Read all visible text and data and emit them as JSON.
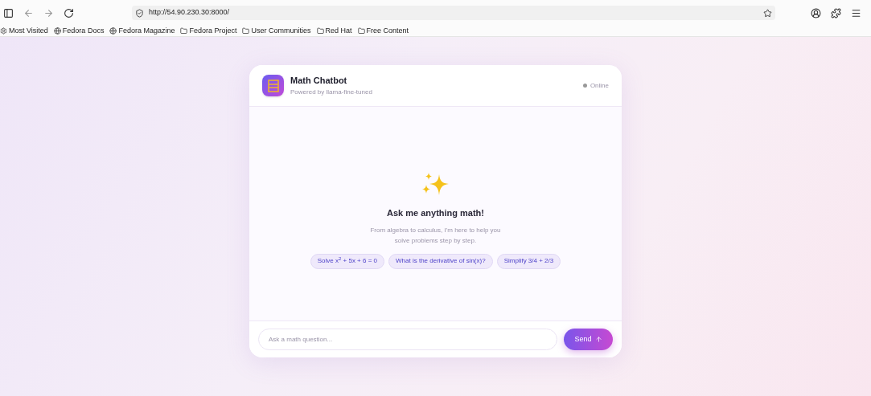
{
  "browser": {
    "url": "http://54.90.230.30:8000/"
  },
  "bookmarks": [
    {
      "label": "Most Visited",
      "kind": "gear"
    },
    {
      "label": "Fedora Docs",
      "kind": "globe"
    },
    {
      "label": "Fedora Magazine",
      "kind": "globe"
    },
    {
      "label": "Fedora Project",
      "kind": "folder"
    },
    {
      "label": "User Communities",
      "kind": "folder"
    },
    {
      "label": "Red Hat",
      "kind": "folder"
    },
    {
      "label": "Free Content",
      "kind": "folder"
    }
  ],
  "chat": {
    "title": "Math Chatbot",
    "subtitle": "Powered by llama-fine-tuned",
    "status": "Online",
    "empty_title": "Ask me anything math!",
    "empty_text": "From algebra to calculus, I'm here to help you solve problems step by step.",
    "suggestions": [
      "Solve x$^{2}$ + 5x + 6 = 0",
      "What is the derivative of sin(x)?",
      "Simplify 3/4 + 2/3"
    ],
    "input": {
      "placeholder": "Ask a math question..."
    },
    "send": "Send"
  }
}
